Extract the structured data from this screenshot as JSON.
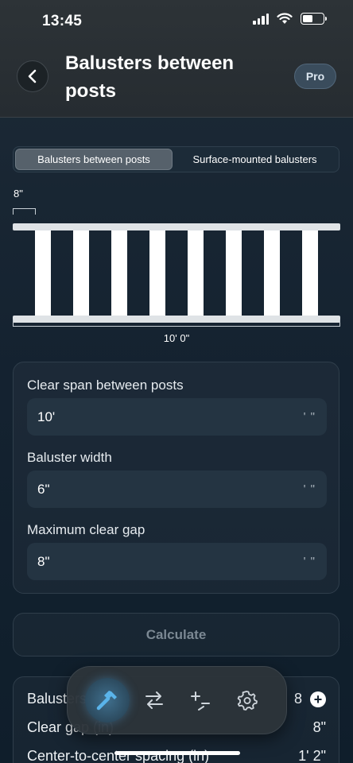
{
  "status": {
    "time": "13:45"
  },
  "header": {
    "title": "Balusters between posts",
    "pro_label": "Pro"
  },
  "tabs": {
    "between": "Balusters between posts",
    "surface": "Surface-mounted balusters"
  },
  "diagram": {
    "gap_label": "8\"",
    "span_label": "10' 0\"",
    "baluster_count": 8,
    "colors": {
      "rail": "#dfe3e6",
      "baluster": "#ffffff",
      "dimension": "#c8d0d6"
    }
  },
  "form": {
    "clear_span": {
      "label": "Clear span between posts",
      "value": "10'",
      "unit": "' \""
    },
    "baluster_width": {
      "label": "Baluster width",
      "value": "6\"",
      "unit": "' \""
    },
    "max_gap": {
      "label": "Maximum clear gap",
      "value": "8\"",
      "unit": "' \""
    }
  },
  "calculate_label": "Calculate",
  "results": {
    "row1": {
      "label": "Balusters",
      "value": "8"
    },
    "row2": {
      "label": "Clear gap (in)",
      "value": "8\""
    },
    "row3": {
      "label": "Center-to-center spacing (in)",
      "value": "1' 2\""
    }
  },
  "tabbar": {
    "items": [
      "hammer-icon",
      "swap-arrows-icon",
      "plus-minus-icon",
      "gear-icon"
    ],
    "active": "hammer-icon",
    "accent": "#5ab4ea"
  }
}
